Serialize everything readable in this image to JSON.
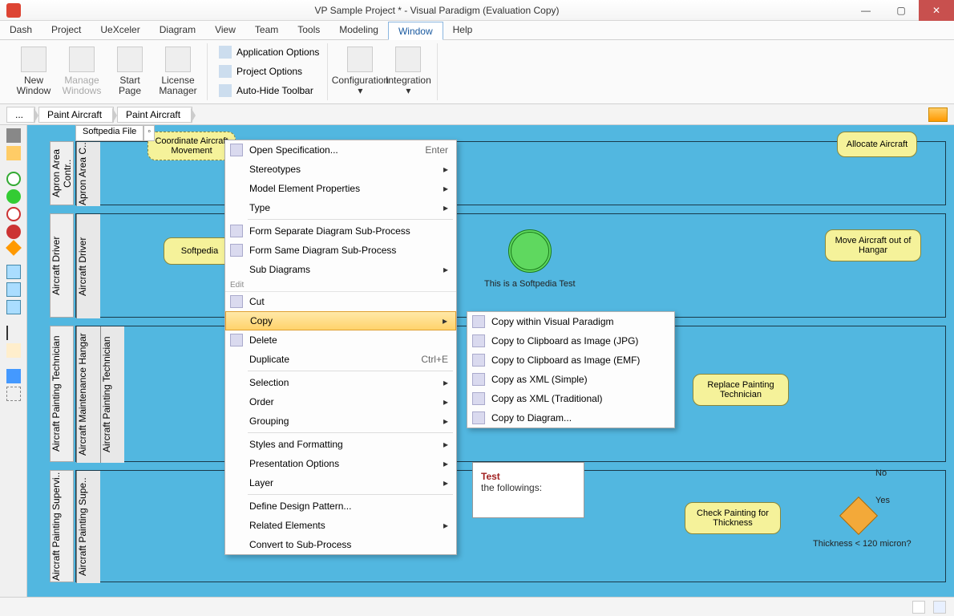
{
  "titlebar": {
    "title": "VP Sample Project * - Visual Paradigm (Evaluation Copy)"
  },
  "menubar": [
    "Dash",
    "Project",
    "UeXceler",
    "Diagram",
    "View",
    "Team",
    "Tools",
    "Modeling",
    "Window",
    "Help"
  ],
  "menubar_active": "Window",
  "ribbon": {
    "big": [
      {
        "label": "New\nWindow",
        "name": "new-window"
      },
      {
        "label": "Manage\nWindows",
        "name": "manage-windows",
        "disabled": true
      },
      {
        "label": "Start\nPage",
        "name": "start-page"
      },
      {
        "label": "License\nManager",
        "name": "license-manager"
      }
    ],
    "small": [
      {
        "label": "Application Options",
        "name": "application-options"
      },
      {
        "label": "Project Options",
        "name": "project-options"
      },
      {
        "label": "Auto-Hide Toolbar",
        "name": "auto-hide-toolbar"
      }
    ],
    "big2": [
      {
        "label": "Configuration",
        "name": "configuration",
        "dropdown": true
      },
      {
        "label": "Integration",
        "name": "integration",
        "dropdown": true
      }
    ]
  },
  "breadcrumb": [
    "...",
    "Paint Aircraft",
    "Paint Aircraft"
  ],
  "tabs": [
    "Softpedia File"
  ],
  "lane_labels": {
    "outer": "Apron Area Contr..",
    "inner1": "Apron Area C..",
    "outer2": "Aircraft Driver",
    "inner2": "Aircraft Driver",
    "outer3": "Aircraft Painting Technician",
    "inner3_a": "Aircraft Maintenance Hangar",
    "inner3_b": "Aircraft Painting Technician",
    "outer4": "Aircraft Painting Supervi..",
    "inner4": "Aircraft Painting Supe.."
  },
  "tasks": {
    "coordinate": "Coordinate Aircraft Movement",
    "allocate": "Allocate Aircraft",
    "softpedia": "Softpedia",
    "moveout": "Move Aircraft out of Hangar",
    "replace": "Replace Painting Technician",
    "check": "Check Painting for Thickness"
  },
  "annotations": {
    "clock_label": "This is a Softpedia Test",
    "note_title": "Test",
    "note_body": "the followings:",
    "gateway_label": "Thickness < 120 micron?",
    "yes": "Yes",
    "no": "No"
  },
  "context_menu": {
    "items": [
      {
        "label": "Open Specification...",
        "shortcut": "Enter",
        "icon": true
      },
      {
        "label": "Stereotypes",
        "submenu": true
      },
      {
        "label": "Model Element Properties",
        "submenu": true
      },
      {
        "label": "Type",
        "submenu": true
      },
      {
        "sep": true
      },
      {
        "label": "Form Separate Diagram Sub-Process",
        "icon": true
      },
      {
        "label": "Form Same Diagram Sub-Process",
        "icon": true
      },
      {
        "label": "Sub Diagrams",
        "submenu": true
      },
      {
        "section": "Edit"
      },
      {
        "label": "Cut",
        "icon": true
      },
      {
        "label": "Copy",
        "submenu": true,
        "hover": true
      },
      {
        "label": "Delete",
        "icon": true
      },
      {
        "label": "Duplicate",
        "shortcut": "Ctrl+E"
      },
      {
        "sep": true
      },
      {
        "label": "Selection",
        "submenu": true
      },
      {
        "label": "Order",
        "submenu": true
      },
      {
        "label": "Grouping",
        "submenu": true
      },
      {
        "sep": true
      },
      {
        "label": "Styles and Formatting",
        "submenu": true
      },
      {
        "label": "Presentation Options",
        "submenu": true
      },
      {
        "label": "Layer",
        "submenu": true
      },
      {
        "sep": true
      },
      {
        "label": "Define Design Pattern..."
      },
      {
        "label": "Related Elements",
        "submenu": true
      },
      {
        "label": "Convert to Sub-Process"
      }
    ],
    "copy_submenu": [
      {
        "label": "Copy within Visual Paradigm"
      },
      {
        "label": "Copy to Clipboard as Image (JPG)"
      },
      {
        "label": "Copy to Clipboard as Image (EMF)"
      },
      {
        "label": "Copy as XML (Simple)"
      },
      {
        "label": "Copy as XML (Traditional)"
      },
      {
        "label": "Copy to Diagram..."
      }
    ]
  }
}
